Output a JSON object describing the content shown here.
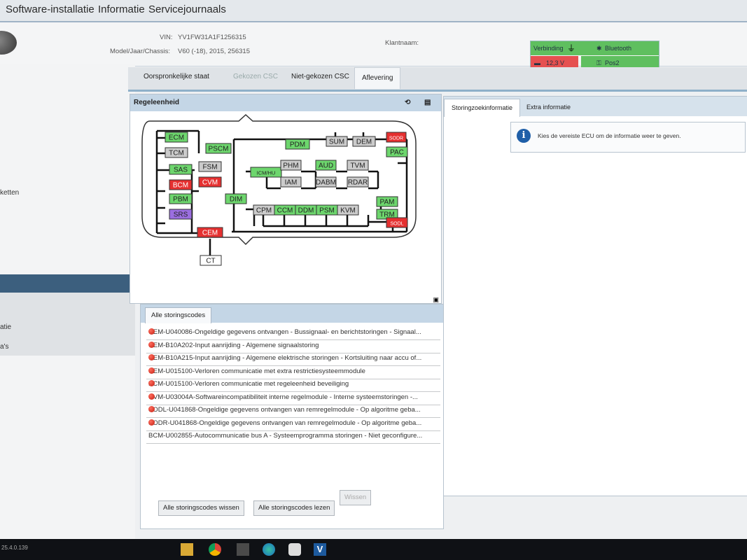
{
  "menu": {
    "items": [
      "Software-installatie",
      "Informatie",
      "Servicejournaals"
    ]
  },
  "vehicle": {
    "vin_label": "VIN:",
    "vin_value": "YV1FW31A1F1256315",
    "model_label": "Model/Jaar/Chassis:",
    "model_value": "V60 (-18), 2015, 256315",
    "customer_label": "Klantnaam:"
  },
  "status": {
    "connection_label": "Verbinding",
    "voltage": "12,3 V",
    "bluetooth_label": "Bluetooth",
    "pos_label": "Pos2",
    "colors": {
      "ok": "#5fbf5f",
      "warn": "#e55050"
    }
  },
  "sidebar": {
    "fragments": [
      "ketten",
      "atie",
      "a's"
    ]
  },
  "tabs": [
    {
      "label": "Oorspronkelijke staat",
      "state": "normal"
    },
    {
      "label": "Gekozen CSC",
      "state": "disabled"
    },
    {
      "label": "Niet-gekozen CSC",
      "state": "normal"
    },
    {
      "label": "Aflevering",
      "state": "active"
    }
  ],
  "ecu_panel": {
    "title": "Regeleenheid",
    "icons": [
      "history-icon",
      "list-icon"
    ],
    "ecus": [
      {
        "name": "ECM",
        "color": "green"
      },
      {
        "name": "TCM",
        "color": "gray"
      },
      {
        "name": "PSCM",
        "color": "green"
      },
      {
        "name": "PDM",
        "color": "green"
      },
      {
        "name": "SUM",
        "color": "gray"
      },
      {
        "name": "DEM",
        "color": "gray"
      },
      {
        "name": "SODR",
        "color": "red"
      },
      {
        "name": "PAC",
        "color": "green"
      },
      {
        "name": "SAS",
        "color": "green"
      },
      {
        "name": "FSM",
        "color": "gray"
      },
      {
        "name": "ICM/HU",
        "color": "green"
      },
      {
        "name": "PHM",
        "color": "gray"
      },
      {
        "name": "AUD",
        "color": "green"
      },
      {
        "name": "TVM",
        "color": "gray"
      },
      {
        "name": "BCM",
        "color": "red"
      },
      {
        "name": "CVM",
        "color": "red"
      },
      {
        "name": "IAM",
        "color": "gray"
      },
      {
        "name": "DABM",
        "color": "gray"
      },
      {
        "name": "RDAR",
        "color": "gray"
      },
      {
        "name": "PBM",
        "color": "green"
      },
      {
        "name": "DIM",
        "color": "green"
      },
      {
        "name": "PAM",
        "color": "green"
      },
      {
        "name": "TRM",
        "color": "green"
      },
      {
        "name": "CPM",
        "color": "gray"
      },
      {
        "name": "CCM",
        "color": "green"
      },
      {
        "name": "DDM",
        "color": "green"
      },
      {
        "name": "PSM",
        "color": "green"
      },
      {
        "name": "KVM",
        "color": "gray"
      },
      {
        "name": "SRS",
        "color": "purple"
      },
      {
        "name": "SODL",
        "color": "red"
      },
      {
        "name": "CEM",
        "color": "red"
      },
      {
        "name": "CT",
        "color": "white"
      }
    ]
  },
  "dtc_panel": {
    "tab_label": "Alle storingscodes",
    "rows": [
      {
        "text": "CEM-U040086-Ongeldige gegevens ontvangen - Bussignaal- en berichtstoringen - Signaal...",
        "active": true
      },
      {
        "text": "CEM-B10A202-Input aanrijding - Algemene signaalstoring",
        "active": true
      },
      {
        "text": "CEM-B10A215-Input aanrijding - Algemene elektrische storingen - Kortsluiting naar accu of...",
        "active": true
      },
      {
        "text": "CEM-U015100-Verloren communicatie met extra restrictiesysteemmodule",
        "active": true
      },
      {
        "text": "BCM-U015100-Verloren communicatie met regeleenheid beveiliging",
        "active": true
      },
      {
        "text": "CVM-U03004A-Softwareincompatibiliteit interne regelmodule - Interne systeemstoringen -...",
        "active": true
      },
      {
        "text": "SODL-U041868-Ongeldige gegevens ontvangen van remregelmodule - Op algoritme geba...",
        "active": true
      },
      {
        "text": "SODR-U041868-Ongeldige gegevens ontvangen van remregelmodule - Op algoritme geba...",
        "active": true
      },
      {
        "text": "BCM-U002855-Autocommunicatie bus A - Systeemprogramma storingen - Niet geconfigure...",
        "active": false
      }
    ]
  },
  "buttons": {
    "clear_all": "Alle storingscodes wissen",
    "read_all": "Alle storingscodes lezen",
    "clear": "Wissen"
  },
  "right_panel": {
    "tabs": [
      "Storingzoekinformatie",
      "Extra informatie"
    ],
    "info_text": "Kies de vereiste ECU om de informatie weer te geven."
  },
  "footer": {
    "version": "25.4.0.139"
  },
  "taskbar": {
    "icons": [
      "folder-icon",
      "chrome-icon",
      "calculator-icon",
      "edge-icon",
      "media-icon",
      "vida-icon"
    ]
  }
}
